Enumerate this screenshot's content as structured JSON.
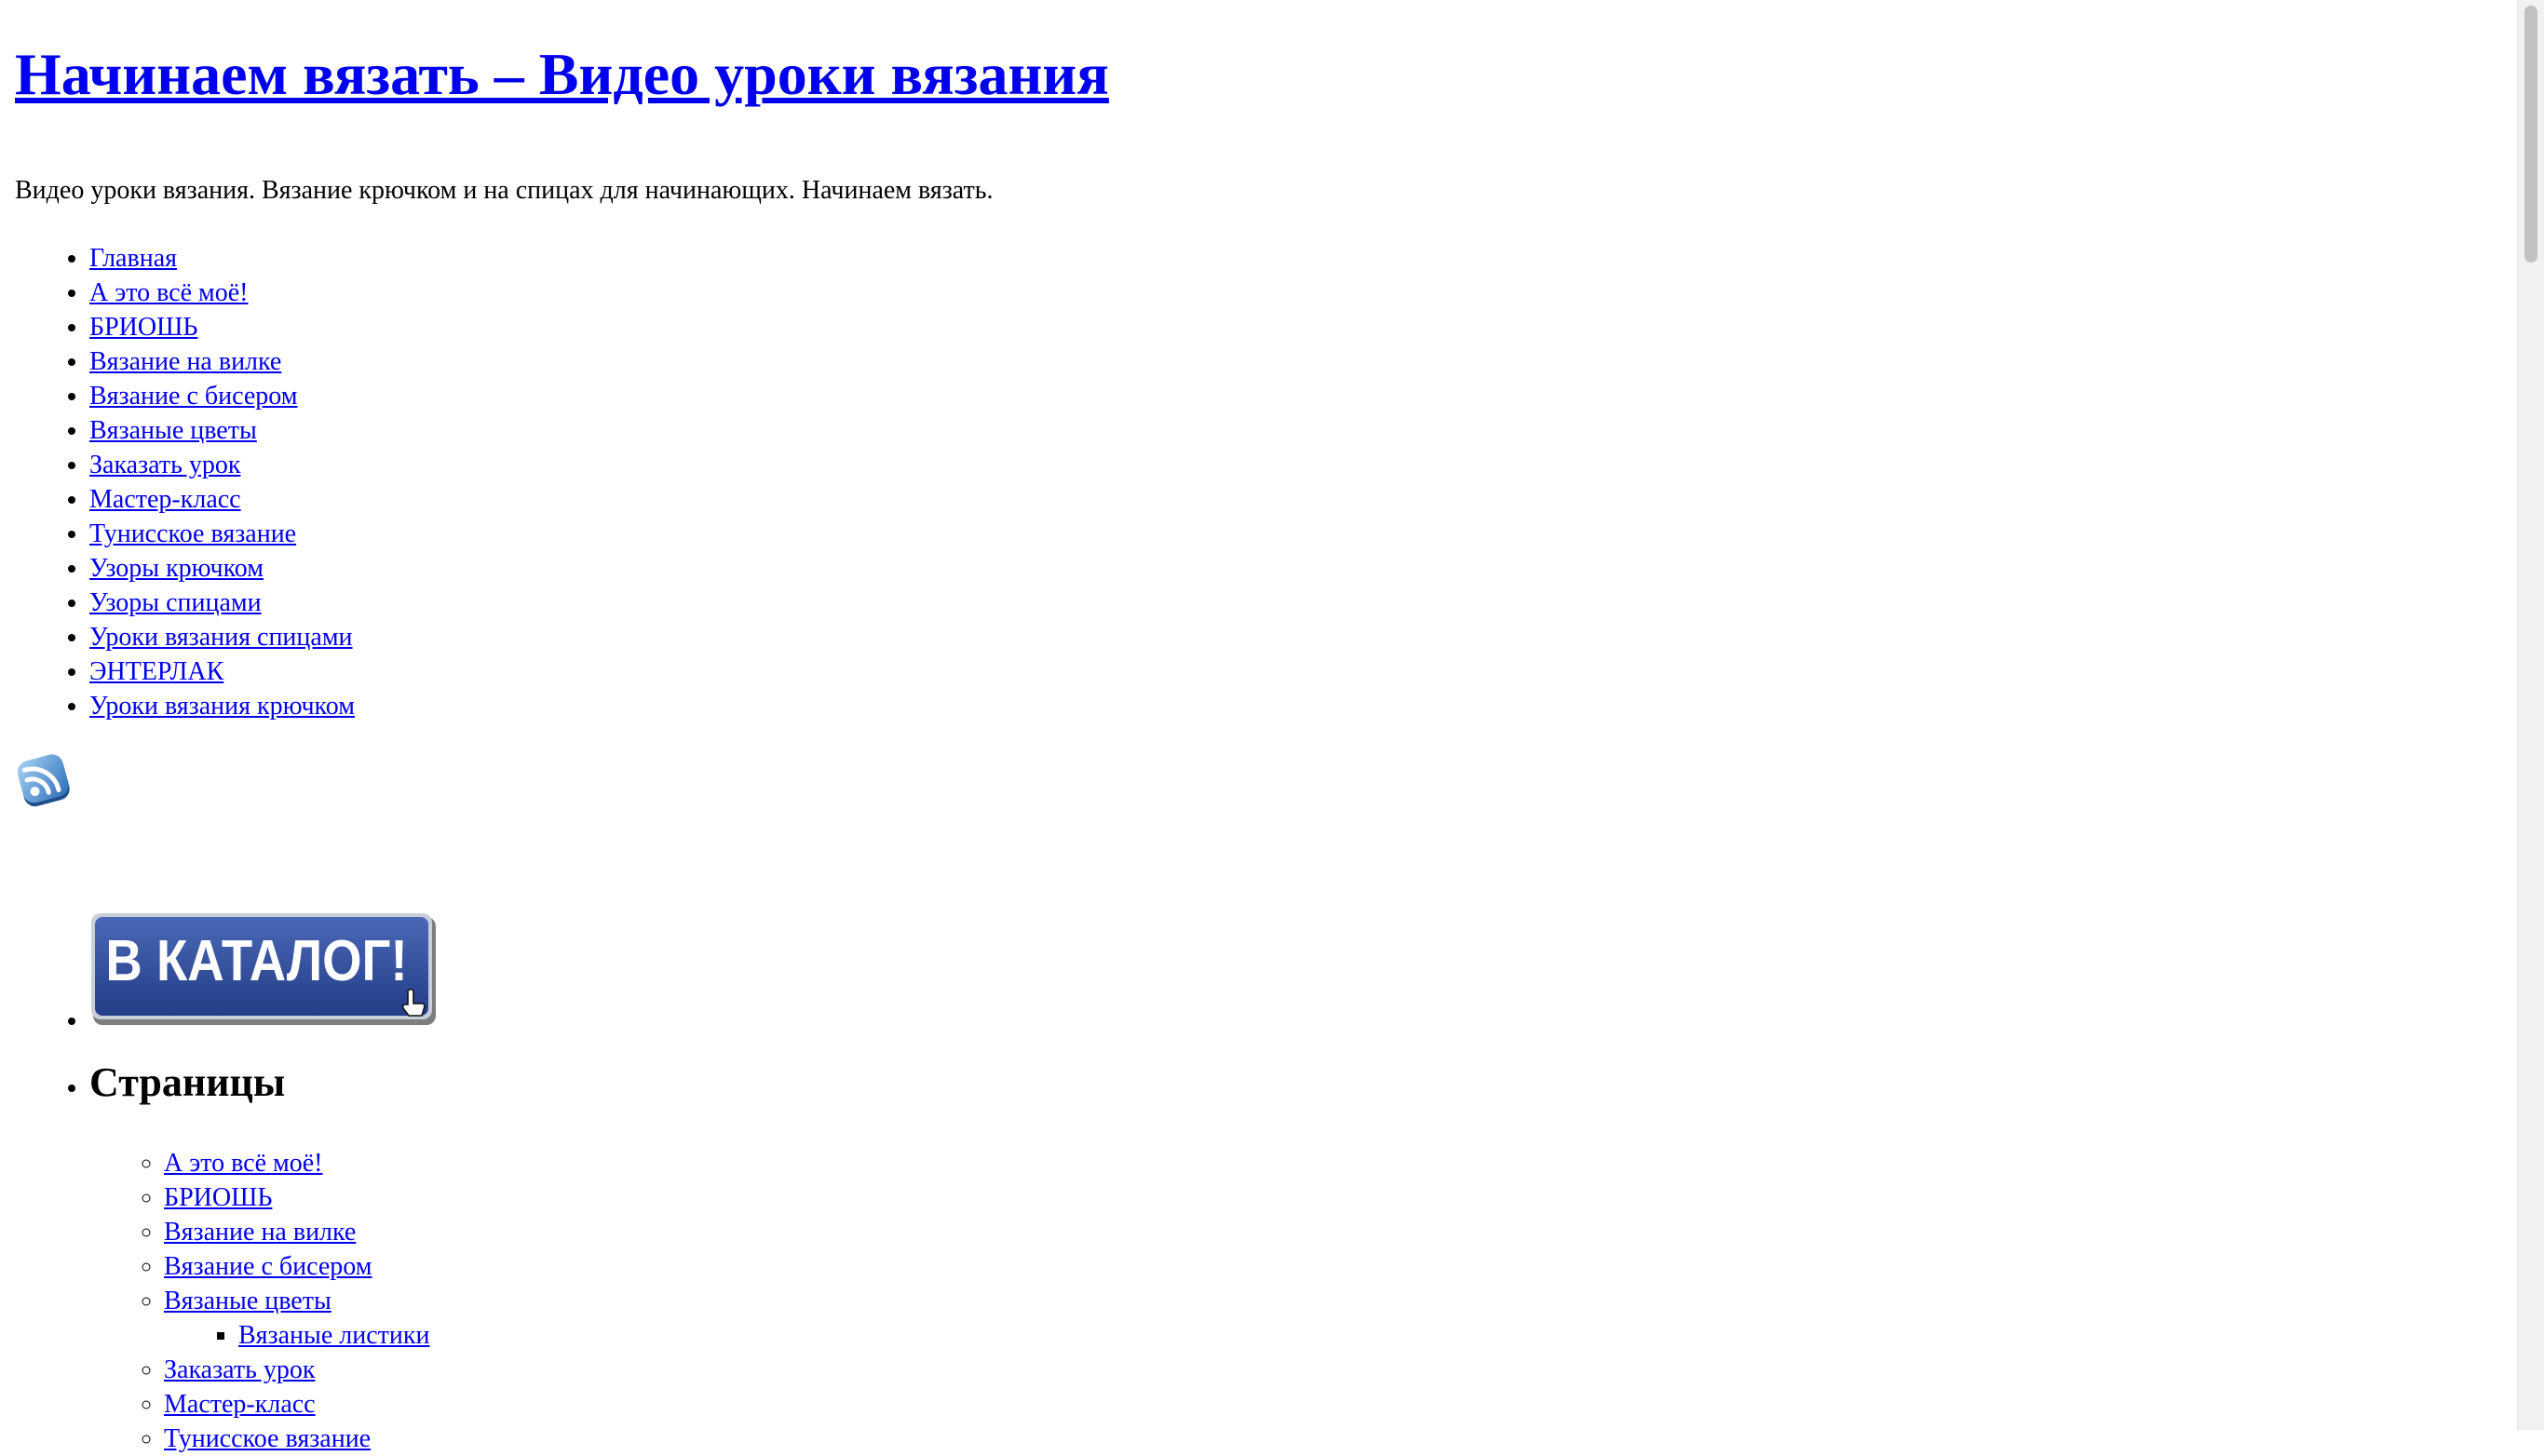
{
  "header": {
    "site_title": "Начинаем вязать – Видео уроки вязания",
    "description": "Видео уроки вязания. Вязание крючком и на спицах для начинающих. Начинаем вязать."
  },
  "main_menu": [
    "Главная",
    "А это всё моё!",
    "БРИОШЬ",
    "Вязание на вилке",
    "Вязание с бисером",
    "Вязаные цветы",
    "Заказать урок",
    "Мастер-класс",
    "Тунисское вязание",
    "Узоры крючком",
    "Узоры спицами",
    "Уроки вязания спицами",
    "ЭНТЕРЛАК",
    "Уроки вязания крючком"
  ],
  "rss": {
    "icon": "rss-icon"
  },
  "catalog_banner": {
    "text": "В КАТАЛОГ!",
    "color": "#2f4b97"
  },
  "pages_widget": {
    "title": "Страницы",
    "items": [
      "А это всё моё!",
      "БРИОШЬ",
      "Вязание на вилке",
      "Вязание с бисером",
      "Вязаные цветы"
    ],
    "subitems": [
      "Вязаные листики"
    ],
    "items_after": [
      "Заказать урок",
      "Мастер-класс",
      "Тунисское вязание"
    ]
  },
  "colors": {
    "link": "#0000ee",
    "text": "#000000",
    "background": "#ffffff"
  }
}
